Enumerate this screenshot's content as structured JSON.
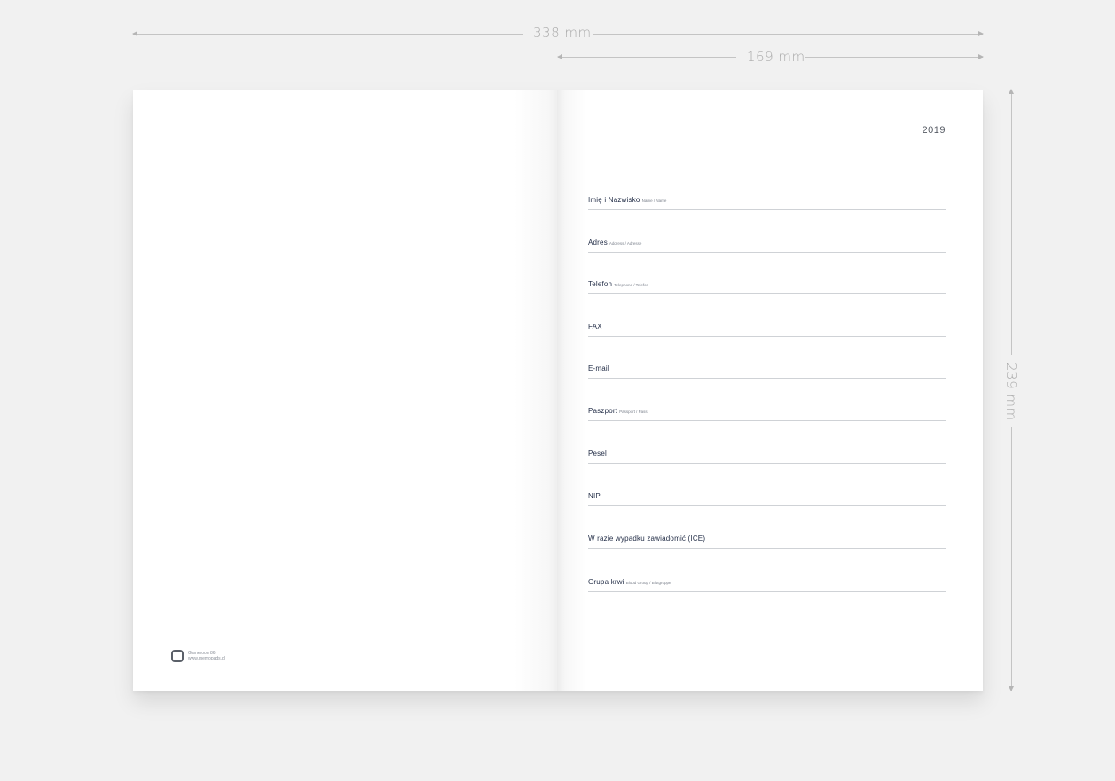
{
  "dimensions": {
    "total_width": "338 mm",
    "page_width": "169 mm",
    "height": "239 mm"
  },
  "left_page": {
    "logo": {
      "icon": "rounded-square-logo-icon",
      "line1": "Gameroon 86",
      "line2": "www.memopads.pl"
    }
  },
  "right_page": {
    "year": "2019",
    "fields": [
      {
        "label": "Imię i Nazwisko",
        "sub": "Name / Name"
      },
      {
        "label": "Adres",
        "sub": "Address / Adresse"
      },
      {
        "label": "Telefon",
        "sub": "Telephone / Telefon"
      },
      {
        "label": "FAX",
        "sub": ""
      },
      {
        "label": "E-mail",
        "sub": ""
      },
      {
        "label": "Paszport",
        "sub": "Passport / Pass"
      },
      {
        "label": "Pesel",
        "sub": ""
      },
      {
        "label": "NIP",
        "sub": ""
      },
      {
        "label": "W razie wypadku zawiadomić (ICE)",
        "sub": ""
      },
      {
        "label": "Grupa krwi",
        "sub": "Blood Group / Blutgruppe"
      }
    ]
  }
}
